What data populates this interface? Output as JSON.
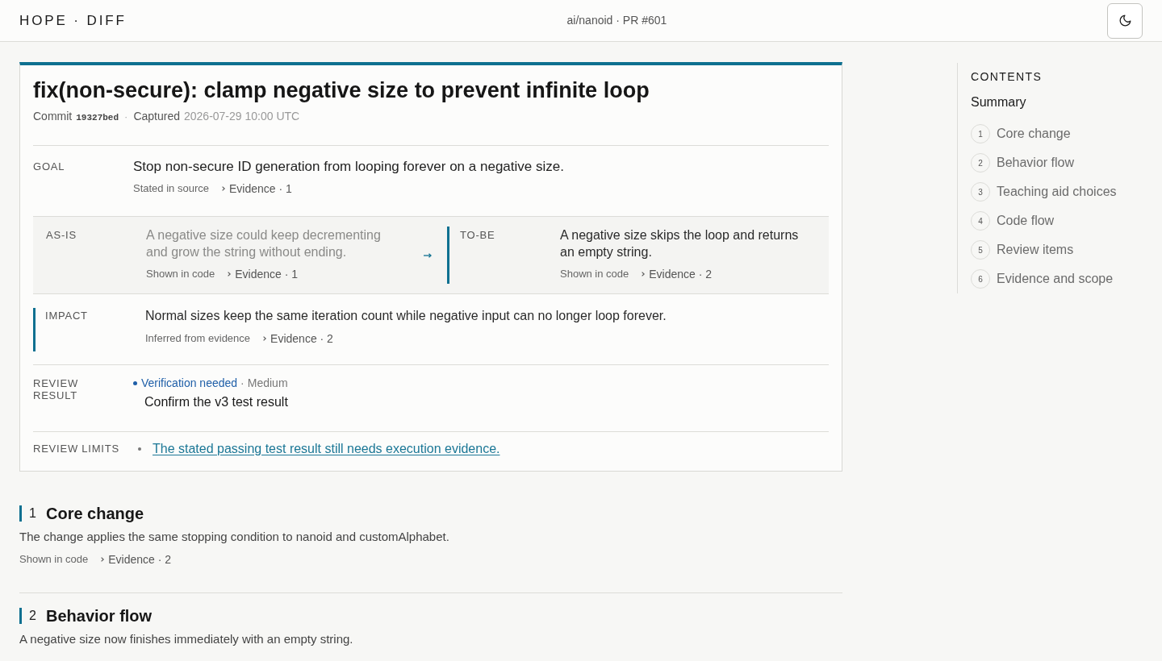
{
  "header": {
    "logo": "HOPE · DIFF",
    "context": "ai/nanoid · PR #601"
  },
  "separator": "·",
  "summary": {
    "title": "fix(non-secure): clamp negative size to prevent infinite loop",
    "meta": [
      {
        "label": "Commit",
        "value": "19327bed",
        "kind": "code"
      },
      {
        "label": "Captured",
        "value": "2026-07-29 10:00 UTC",
        "kind": "text"
      }
    ],
    "goal": {
      "label": "GOAL",
      "text": "Stop non-secure ID generation from looping forever on a negative size.",
      "source": "Stated in source",
      "evidence": "Evidence · 1"
    },
    "as_is": {
      "label": "AS-IS",
      "text": "A negative size could keep decrementing and grow the string without ending.",
      "source": "Shown in code",
      "evidence": "Evidence · 1"
    },
    "to_be": {
      "label": "TO-BE",
      "text": "A negative size skips the loop and returns an empty string.",
      "source": "Shown in code",
      "evidence": "Evidence · 2"
    },
    "impact": {
      "label": "IMPACT",
      "text": "Normal sizes keep the same iteration count while negative input can no longer loop forever.",
      "source": "Inferred from evidence",
      "evidence": "Evidence · 2"
    },
    "review_result": {
      "label": "REVIEW RESULT",
      "status": "Verification needed",
      "severity": "Medium",
      "item": "Confirm the v3 test result"
    },
    "review_limits": {
      "label": "REVIEW LIMITS",
      "items": [
        "The stated passing test result still needs execution evidence."
      ]
    }
  },
  "sections": [
    {
      "number": "1",
      "title": "Core change",
      "text": "The change applies the same stopping condition to nanoid and customAlphabet.",
      "source": "Shown in code",
      "evidence": "Evidence · 2"
    },
    {
      "number": "2",
      "title": "Behavior flow",
      "text": "A negative size now finishes immediately with an empty string."
    }
  ],
  "contents": {
    "title": "CONTENTS",
    "items": [
      {
        "label": "Summary",
        "selected": true
      },
      {
        "number": "1",
        "label": "Core change",
        "selected": false
      },
      {
        "number": "2",
        "label": "Behavior flow",
        "selected": false
      },
      {
        "number": "3",
        "label": "Teaching aid choices",
        "selected": false
      },
      {
        "number": "4",
        "label": "Code flow",
        "selected": false
      },
      {
        "number": "5",
        "label": "Review items",
        "selected": false
      },
      {
        "number": "6",
        "label": "Evidence and scope",
        "selected": false
      }
    ]
  }
}
